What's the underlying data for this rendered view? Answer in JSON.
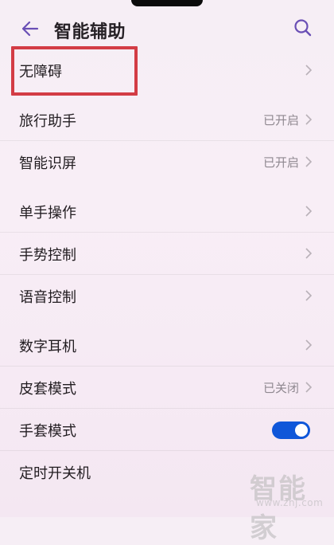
{
  "status_bar": {
    "notch": "camera-notch"
  },
  "header": {
    "title": "智能辅助",
    "back_icon": "back-arrow-icon",
    "search_icon": "search-icon"
  },
  "menu": {
    "items": [
      {
        "label": "无障碍",
        "status": "",
        "control": "chevron"
      },
      {
        "label": "旅行助手",
        "status": "已开启",
        "control": "chevron"
      },
      {
        "label": "智能识屏",
        "status": "已开启",
        "control": "chevron"
      },
      {
        "label": "单手操作",
        "status": "",
        "control": "chevron"
      },
      {
        "label": "手势控制",
        "status": "",
        "control": "chevron"
      },
      {
        "label": "语音控制",
        "status": "",
        "control": "chevron"
      },
      {
        "label": "数字耳机",
        "status": "",
        "control": "chevron"
      },
      {
        "label": "皮套模式",
        "status": "已关闭",
        "control": "chevron"
      },
      {
        "label": "手套模式",
        "status": "",
        "control": "toggle",
        "toggle_on": true
      },
      {
        "label": "定时开关机",
        "status": "",
        "control": "none"
      }
    ]
  },
  "highlight": {
    "target": "无障碍",
    "color": "#d33c45"
  },
  "watermark": {
    "brand": "智能家",
    "url": "www.znj.com"
  },
  "colors": {
    "toggle_on": "#0f57d9",
    "accent_icon": "#6a4fb5",
    "background": "#f6eef5"
  }
}
